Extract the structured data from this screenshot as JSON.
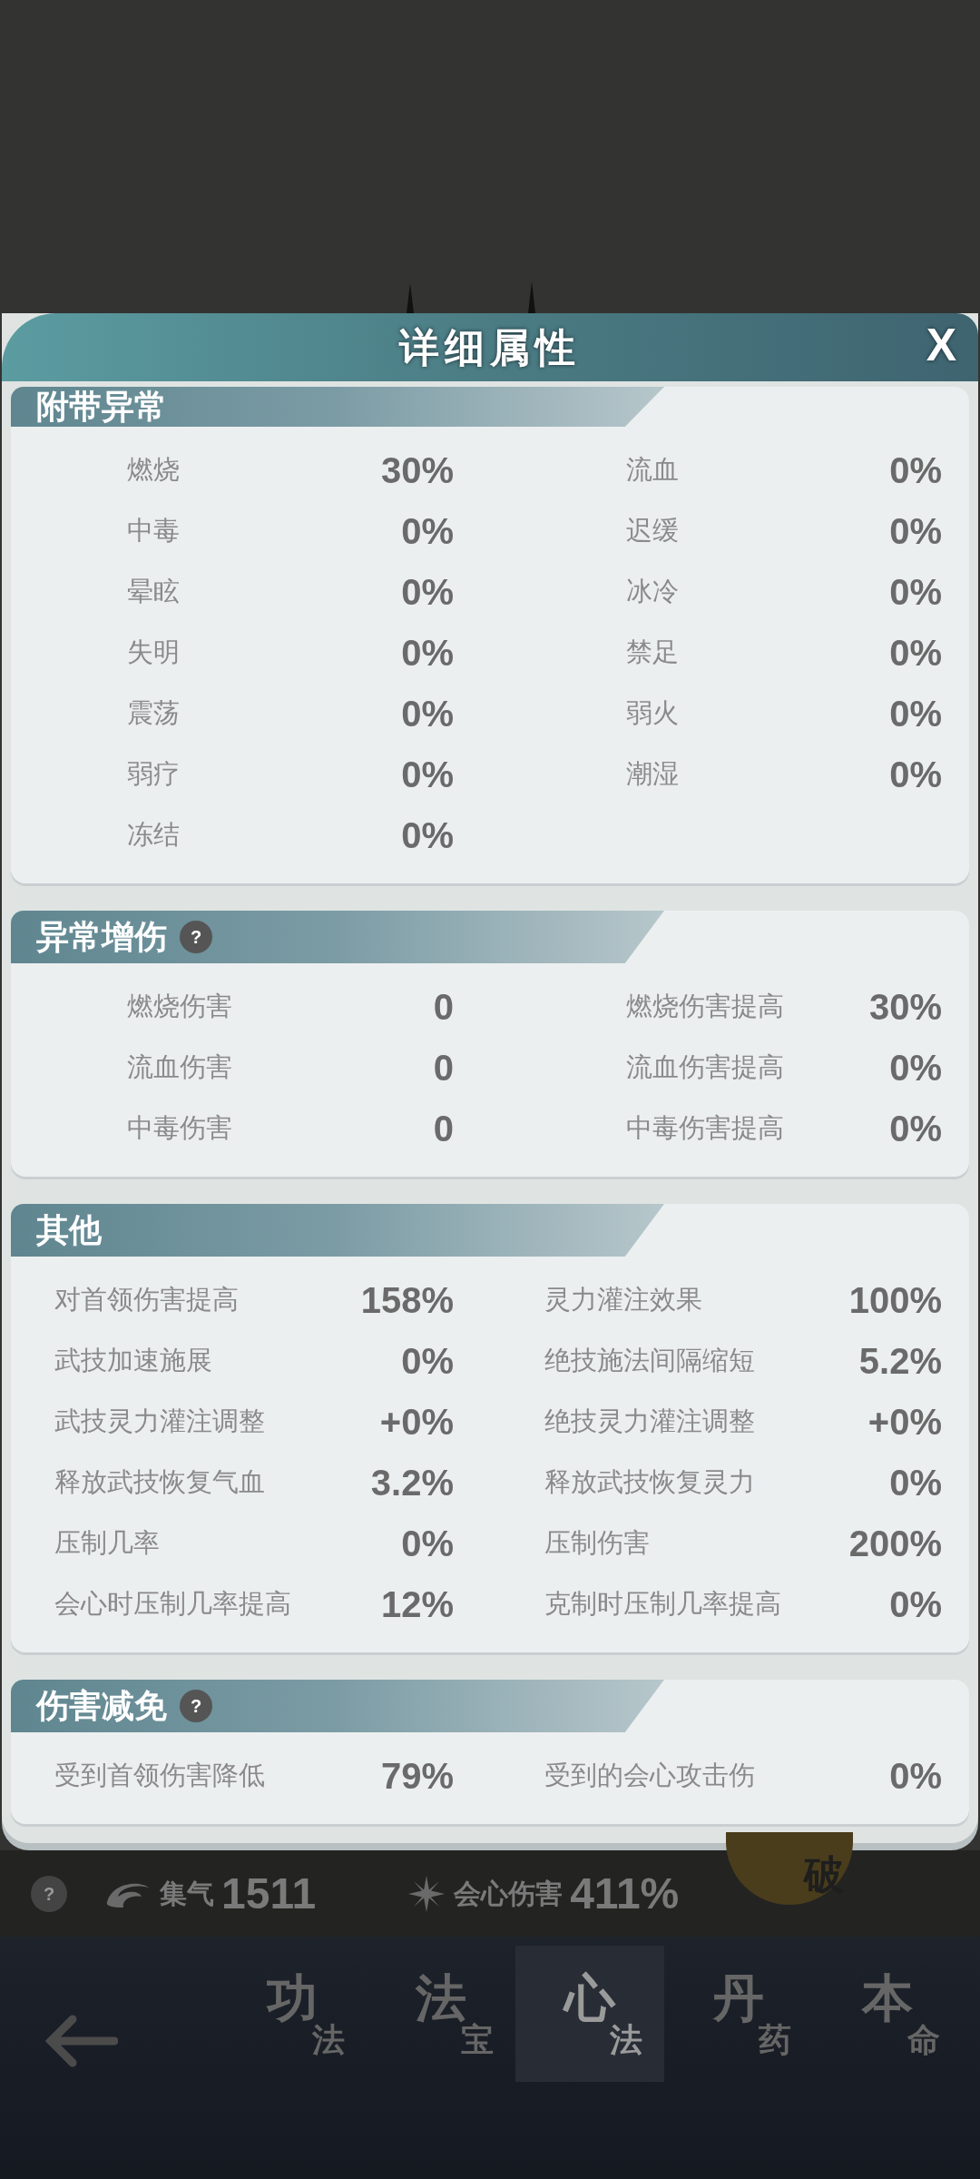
{
  "dialog": {
    "title": "详细属性",
    "close": "X"
  },
  "sections": [
    {
      "title": "附带异常",
      "kind": "compact",
      "stats": [
        {
          "label": "燃烧",
          "value": "30%"
        },
        {
          "label": "流血",
          "value": "0%"
        },
        {
          "label": "中毒",
          "value": "0%"
        },
        {
          "label": "迟缓",
          "value": "0%"
        },
        {
          "label": "晕眩",
          "value": "0%"
        },
        {
          "label": "冰冷",
          "value": "0%"
        },
        {
          "label": "失明",
          "value": "0%"
        },
        {
          "label": "禁足",
          "value": "0%"
        },
        {
          "label": "震荡",
          "value": "0%"
        },
        {
          "label": "弱火",
          "value": "0%"
        },
        {
          "label": "弱疗",
          "value": "0%"
        },
        {
          "label": "潮湿",
          "value": "0%"
        },
        {
          "label": "冻结",
          "value": "0%"
        }
      ]
    },
    {
      "title": "异常增伤",
      "help": "?",
      "kind": "compact",
      "stats": [
        {
          "label": "燃烧伤害",
          "value": "0"
        },
        {
          "label": "燃烧伤害提高",
          "value": "30%"
        },
        {
          "label": "流血伤害",
          "value": "0"
        },
        {
          "label": "流血伤害提高",
          "value": "0%"
        },
        {
          "label": "中毒伤害",
          "value": "0"
        },
        {
          "label": "中毒伤害提高",
          "value": "0%"
        }
      ]
    },
    {
      "title": "其他",
      "kind": "wide",
      "stats": [
        {
          "label": "对首领伤害提高",
          "value": "158%"
        },
        {
          "label": "灵力灌注效果",
          "value": "100%"
        },
        {
          "label": "武技加速施展",
          "value": "0%"
        },
        {
          "label": "绝技施法间隔缩短",
          "value": "5.2%"
        },
        {
          "label": "武技灵力灌注调整",
          "value": "+0%"
        },
        {
          "label": "绝技灵力灌注调整",
          "value": "+0%"
        },
        {
          "label": "释放武技恢复气血",
          "value": "3.2%"
        },
        {
          "label": "释放武技恢复灵力",
          "value": "0%"
        },
        {
          "label": "压制几率",
          "value": "0%"
        },
        {
          "label": "压制伤害",
          "value": "200%"
        },
        {
          "label": "会心时压制几率提高",
          "value": "12%"
        },
        {
          "label": "克制时压制几率提高",
          "value": "0%"
        }
      ]
    },
    {
      "title": "伤害减免",
      "help": "?",
      "kind": "wide",
      "stats": [
        {
          "label": "受到首领伤害降低",
          "value": "79%"
        },
        {
          "label": "受到的会心攻击伤",
          "value": "0%"
        }
      ]
    }
  ],
  "background": {
    "help": "?",
    "stats": [
      {
        "kind": "swirl",
        "label": "集气",
        "value": "1511"
      },
      {
        "kind": "burst",
        "label": "会心伤害",
        "value": "411%"
      }
    ],
    "badge": "破",
    "tabs": [
      {
        "main": "功",
        "sub": "法",
        "selected": false
      },
      {
        "main": "法",
        "sub": "宝",
        "selected": false
      },
      {
        "main": "心",
        "sub": "法",
        "selected": true
      },
      {
        "main": "丹",
        "sub": "药",
        "selected": false
      },
      {
        "main": "本",
        "sub": "命",
        "selected": false
      }
    ]
  }
}
